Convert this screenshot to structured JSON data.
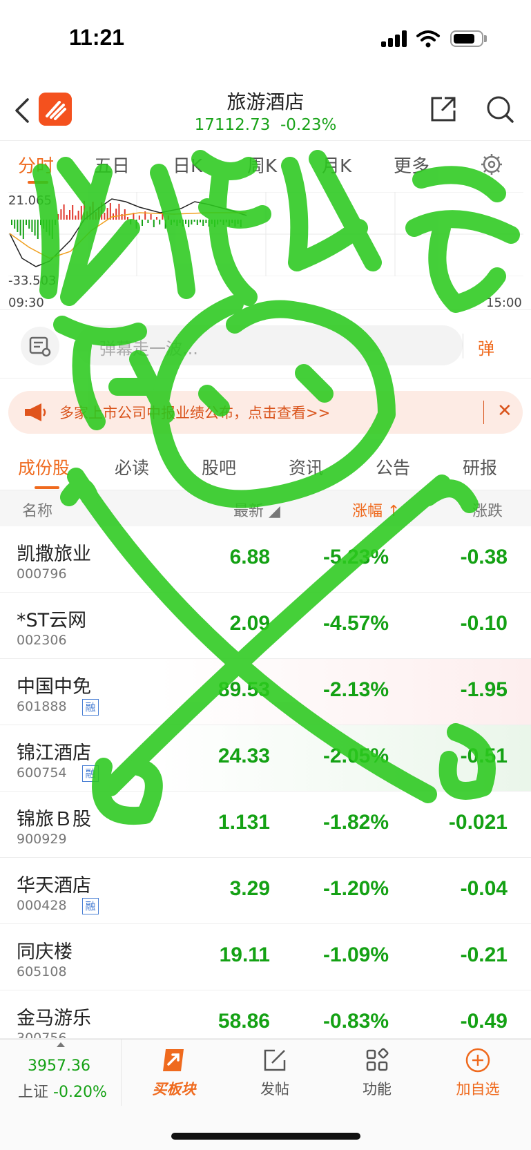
{
  "status_bar": {
    "time": "11:21"
  },
  "header": {
    "title": "旅游酒店",
    "index_value": "17112.73",
    "index_change": "-0.23%"
  },
  "period_tabs": [
    "分时",
    "五日",
    "日K",
    "周K",
    "月K",
    "更多"
  ],
  "intraday_chart": {
    "y_max": "21.065",
    "y_min": "-33.503",
    "x_start": "09:30",
    "x_end": "15:00"
  },
  "danmu": {
    "placeholder": "弹幕走一波...",
    "toggle_label": "弹"
  },
  "notice": {
    "text": "多家上市公司中报业绩公布，点击查看>>"
  },
  "sub_tabs": [
    "成份股",
    "必读",
    "股吧",
    "资讯",
    "公告",
    "研报"
  ],
  "table": {
    "headers": {
      "name": "名称",
      "price": "最新",
      "pct": "涨幅",
      "chg": "涨跌"
    },
    "rows": [
      {
        "name": "凯撒旅业",
        "code": "000796",
        "margin": "",
        "price": "6.88",
        "pct": "-5.23%",
        "chg": "-0.38"
      },
      {
        "name": "*ST云网",
        "code": "002306",
        "margin": "",
        "price": "2.09",
        "pct": "-4.57%",
        "chg": "-0.10"
      },
      {
        "name": "中国中免",
        "code": "601888",
        "margin": "融",
        "price": "89.53",
        "pct": "-2.13%",
        "chg": "-1.95"
      },
      {
        "name": "锦江酒店",
        "code": "600754",
        "margin": "融",
        "price": "24.33",
        "pct": "-2.05%",
        "chg": "-0.51"
      },
      {
        "name": "锦旅Ｂ股",
        "code": "900929",
        "margin": "",
        "price": "1.131",
        "pct": "-1.82%",
        "chg": "-0.021"
      },
      {
        "name": "华天酒店",
        "code": "000428",
        "margin": "融",
        "price": "3.29",
        "pct": "-1.20%",
        "chg": "-0.04"
      },
      {
        "name": "同庆楼",
        "code": "605108",
        "margin": "",
        "price": "19.11",
        "pct": "-1.09%",
        "chg": "-0.21"
      },
      {
        "name": "金马游乐",
        "code": "300756",
        "margin": "",
        "price": "58.86",
        "pct": "-0.83%",
        "chg": "-0.49"
      }
    ]
  },
  "bottom_bar": {
    "index_value": "3957.36",
    "index_name": "上证",
    "index_change": "-0.20%",
    "nav": [
      "买板块",
      "发帖",
      "功能",
      "加自选"
    ]
  },
  "colors": {
    "accent": "#ef6a1e",
    "down": "#14a114",
    "up": "#e0352b",
    "doodle": "#2bc91e"
  }
}
